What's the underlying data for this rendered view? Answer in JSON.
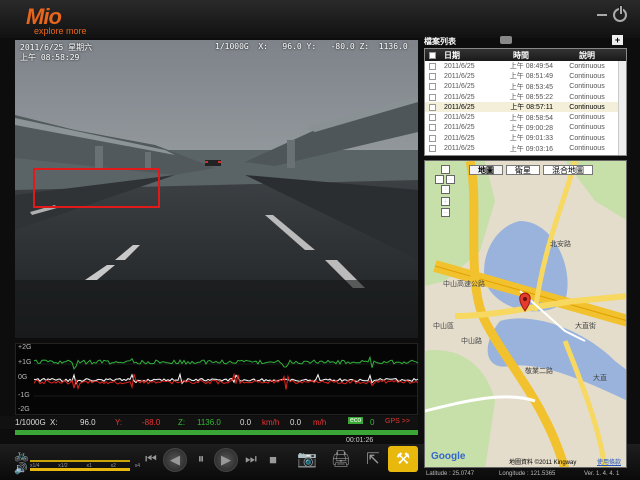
{
  "app": {
    "logo": "Mio",
    "tagline": "explore more",
    "version": "Ver. 1. 4. 4. 1"
  },
  "video": {
    "osd_datetime": "2011/6/25 星期六",
    "osd_time": "上午 08:58:29",
    "osd_gsensor": "1/1000G  X:   96.0 Y:   -80.0 Z:  1136.0"
  },
  "graph": {
    "labels": [
      "+2G",
      "+1G",
      "0G",
      "-1G",
      "-2G"
    ]
  },
  "readout": {
    "scale": "1/1000G",
    "x_label": "X:",
    "x_val": "96.0",
    "y_label": "Y:",
    "y_val": "-88.0",
    "z_label": "Z:",
    "z_val": "1136.0",
    "speed1": "0.0",
    "unit1": "km/h",
    "speed2": "0.0",
    "unit2": "m/h",
    "eco": "eco",
    "eco_val": "0",
    "gps": "GPS >>"
  },
  "playback": {
    "current_time": "00:01:26",
    "progress": 1.0,
    "speed_marks": [
      "x1/4",
      "x1/2",
      "x1",
      "x2",
      "x4"
    ]
  },
  "file_list": {
    "title": "檔案列表",
    "headers": {
      "date": "日期",
      "time": "時間",
      "desc": "說明"
    },
    "rows": [
      {
        "date": "2011/6/25",
        "time": "上午 08:49:54",
        "desc": "Continuous",
        "selected": false
      },
      {
        "date": "2011/6/25",
        "time": "上午 08:51:49",
        "desc": "Continuous",
        "selected": false
      },
      {
        "date": "2011/6/25",
        "time": "上午 08:53:45",
        "desc": "Continuous",
        "selected": false
      },
      {
        "date": "2011/6/25",
        "time": "上午 08:55:22",
        "desc": "Continuous",
        "selected": false
      },
      {
        "date": "2011/6/25",
        "time": "上午 08:57:11",
        "desc": "Continuous",
        "selected": true
      },
      {
        "date": "2011/6/25",
        "time": "上午 08:58:54",
        "desc": "Continuous",
        "selected": false
      },
      {
        "date": "2011/6/25",
        "time": "上午 09:00:28",
        "desc": "Continuous",
        "selected": false
      },
      {
        "date": "2011/6/25",
        "time": "上午 09:01:33",
        "desc": "Continuous",
        "selected": false
      },
      {
        "date": "2011/6/25",
        "time": "上午 09:03:16",
        "desc": "Continuous",
        "selected": false
      }
    ]
  },
  "map": {
    "tabs": [
      "地圖",
      "衛星",
      "混合地圖"
    ],
    "road_labels": [
      "中山高速公路",
      "中山路",
      "北安路",
      "大直街",
      "中山區",
      "大直",
      "敬業二路"
    ],
    "copyright": "地圖資料 ©2011 Kingway",
    "terms": "使用條款",
    "google": "Google"
  },
  "status": {
    "latitude": "Latitude : 25.0747",
    "longitude": "Longitude : 121.5365"
  }
}
